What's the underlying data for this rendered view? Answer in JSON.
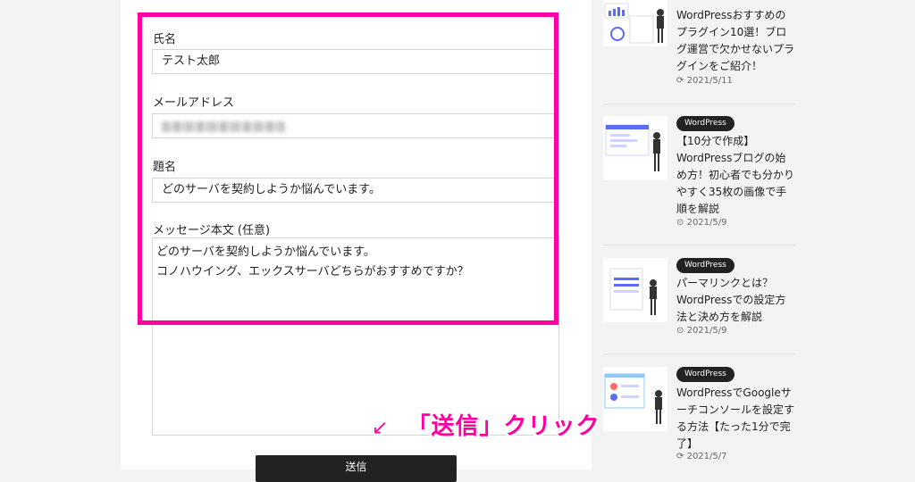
{
  "form": {
    "name_label": "氏名",
    "name_value": "テスト太郎",
    "email_label": "メールアドレス",
    "subject_label": "題名",
    "subject_value": "どのサーバを契約しようか悩んでいます。",
    "message_label": "メッセージ本文 (任意)",
    "message_line1": "どのサーバを契約しようか悩んでいます。",
    "message_line2": "コノハウイング、エックスサーバどちらがおすすめですか？",
    "send_label": "送信"
  },
  "annotation": {
    "arrow": "↙",
    "text": "「送信」クリック"
  },
  "sidebar": {
    "posts": [
      {
        "badge": "",
        "title": "WordPressおすすめのプラグイン10選！ブログ運営で欠かせないプラグインをご紹介！",
        "date": "2021/5/11",
        "date_icon": "refresh-icon"
      },
      {
        "badge": "WordPress",
        "title": "【10分で作成】WordPressブログの始め方！初心者でも分かりやすく35枚の画像で手順を解説",
        "date": "2021/5/9",
        "date_icon": "clock-icon"
      },
      {
        "badge": "WordPress",
        "title": "パーマリンクとは？WordPressでの設定方法と決め方を解説",
        "date": "2021/5/9",
        "date_icon": "clock-icon"
      },
      {
        "badge": "WordPress",
        "title": "WordPressでGoogleサーチコンソールを設定する方法【たった1分で完了】",
        "date": "2021/5/7",
        "date_icon": "refresh-icon"
      }
    ]
  },
  "colors": {
    "highlight": "#ff00a0",
    "button": "#222222"
  }
}
